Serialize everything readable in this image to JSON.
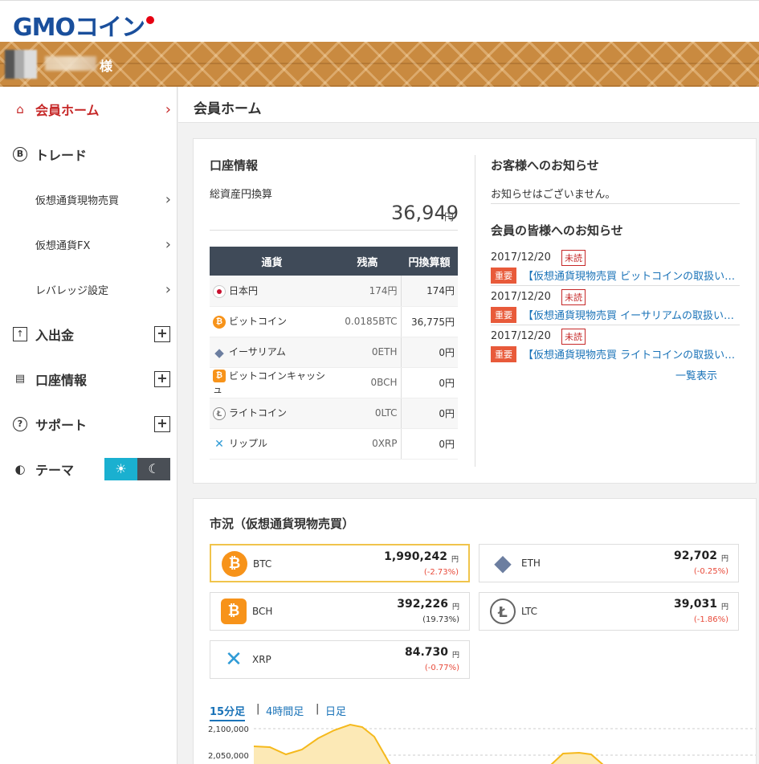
{
  "header": {
    "logo_text": "GMOコイン"
  },
  "user": {
    "suffix": "様"
  },
  "sidebar": {
    "items": [
      {
        "label": "会員ホーム",
        "icon": "home-icon",
        "active": true
      },
      {
        "label": "トレード",
        "icon": "bitcoin-icon"
      },
      {
        "label": "仮想通貨現物売買",
        "sub": true
      },
      {
        "label": "仮想通貨FX",
        "sub": true
      },
      {
        "label": "レバレッジ設定",
        "sub": true
      },
      {
        "label": "入出金",
        "icon": "deposit-icon"
      },
      {
        "label": "口座情報",
        "icon": "account-icon"
      },
      {
        "label": "サポート",
        "icon": "question-icon"
      },
      {
        "label": "テーマ",
        "icon": "palette-icon"
      }
    ],
    "theme_toggle": {
      "light_icon": "☀",
      "dark_icon": "☾"
    }
  },
  "main": {
    "page_title": "会員ホーム",
    "account": {
      "title": "口座情報",
      "total_label": "総資産円換算",
      "total_value": "36,949",
      "total_unit": "円",
      "table_headers": [
        "通貨",
        "残高",
        "円換算額"
      ],
      "rows": [
        {
          "name": "日本円",
          "icon": "jpy-icon",
          "balance": "174円",
          "yen": "174円"
        },
        {
          "name": "ビットコイン",
          "icon": "btc-icon",
          "balance": "0.0185BTC",
          "yen": "36,775円"
        },
        {
          "name": "イーサリアム",
          "icon": "eth-icon",
          "balance": "0ETH",
          "yen": "0円"
        },
        {
          "name": "ビットコインキャッシュ",
          "icon": "bch-icon",
          "balance": "0BCH",
          "yen": "0円"
        },
        {
          "name": "ライトコイン",
          "icon": "ltc-icon",
          "balance": "0LTC",
          "yen": "0円"
        },
        {
          "name": "リップル",
          "icon": "xrp-icon",
          "balance": "0XRP",
          "yen": "0円"
        }
      ]
    },
    "notices": {
      "customer_title": "お客様へのお知らせ",
      "customer_empty": "お知らせはございません。",
      "members_title": "会員の皆様へのお知らせ",
      "items": [
        {
          "date": "2017/12/20",
          "unread": "未読",
          "importance": "重要",
          "text": "【仮想通貨現物売買 ビットコインの取扱い開始について】"
        },
        {
          "date": "2017/12/20",
          "unread": "未読",
          "importance": "重要",
          "text": "【仮想通貨現物売買 イーサリアムの取扱い開始について】"
        },
        {
          "date": "2017/12/20",
          "unread": "未読",
          "importance": "重要",
          "text": "【仮想通貨現物売買 ライトコインの取扱い開始について】"
        }
      ],
      "more": "一覧表示"
    },
    "market": {
      "title": "市況（仮想通貨現物売買）",
      "unit": "円",
      "items": [
        {
          "symbol": "BTC",
          "icon": "btc-icon",
          "price": "1,990,242",
          "change": "(-2.73%)",
          "dir": "neg"
        },
        {
          "symbol": "ETH",
          "icon": "eth-icon",
          "price": "92,702",
          "change": "(-0.25%)",
          "dir": "neg"
        },
        {
          "symbol": "BCH",
          "icon": "bch-icon",
          "price": "392,226",
          "change": "(19.73%)",
          "dir": "pos"
        },
        {
          "symbol": "LTC",
          "icon": "ltc-icon",
          "price": "39,031",
          "change": "(-1.86%)",
          "dir": "neg"
        },
        {
          "symbol": "XRP",
          "icon": "xrp-icon",
          "price": "84.730",
          "change": "(-0.77%)",
          "dir": "neg"
        }
      ],
      "tabs": [
        "15分足",
        "4時間足",
        "日足"
      ],
      "active_tab": "15分足",
      "y_ticks": [
        "2,100,000",
        "2,050,000"
      ],
      "colors": {
        "fill": "#fce9b6",
        "line": "#f5b91c"
      }
    }
  }
}
